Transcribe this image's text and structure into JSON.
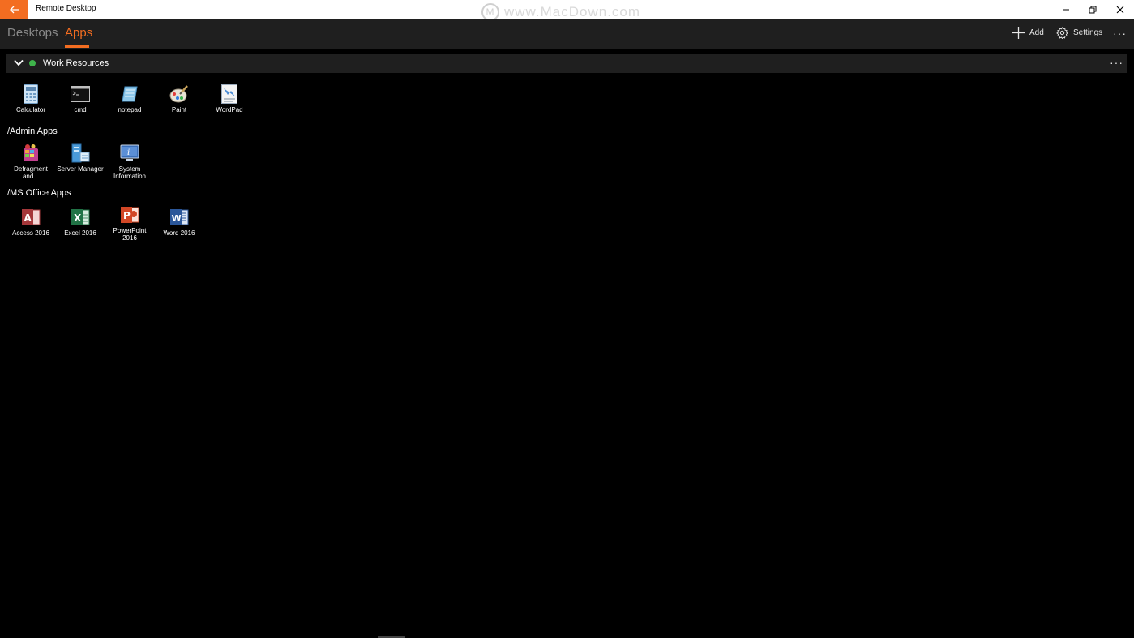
{
  "titlebar": {
    "title": "Remote Desktop",
    "watermark": "www.MacDown.com"
  },
  "nav": {
    "tabs": [
      {
        "label": "Desktops"
      },
      {
        "label": "Apps"
      }
    ],
    "add_label": "Add",
    "settings_label": "Settings",
    "more_label": "···"
  },
  "group": {
    "name": "Work Resources",
    "more_label": "···",
    "status": "connected"
  },
  "sections": {
    "root": {
      "apps": [
        {
          "label": "Calculator",
          "icon": "calculator-icon"
        },
        {
          "label": "cmd",
          "icon": "cmd-icon"
        },
        {
          "label": "notepad",
          "icon": "notepad-icon"
        },
        {
          "label": "Paint",
          "icon": "paint-icon"
        },
        {
          "label": "WordPad",
          "icon": "wordpad-icon"
        }
      ]
    },
    "admin": {
      "title": "/Admin Apps",
      "apps": [
        {
          "label": "Defragment and...",
          "icon": "defragment-icon"
        },
        {
          "label": "Server Manager",
          "icon": "server-manager-icon"
        },
        {
          "label": "System Information",
          "icon": "system-information-icon"
        }
      ]
    },
    "office": {
      "title": "/MS Office Apps",
      "apps": [
        {
          "label": "Access 2016",
          "icon": "access-icon"
        },
        {
          "label": "Excel 2016",
          "icon": "excel-icon"
        },
        {
          "label": "PowerPoint 2016",
          "icon": "powerpoint-icon"
        },
        {
          "label": "Word 2016",
          "icon": "word-icon"
        }
      ]
    }
  },
  "colors": {
    "accent": "#f36d21",
    "background": "#000000",
    "bar": "#1f1f1f",
    "status": "#3fb44b"
  }
}
